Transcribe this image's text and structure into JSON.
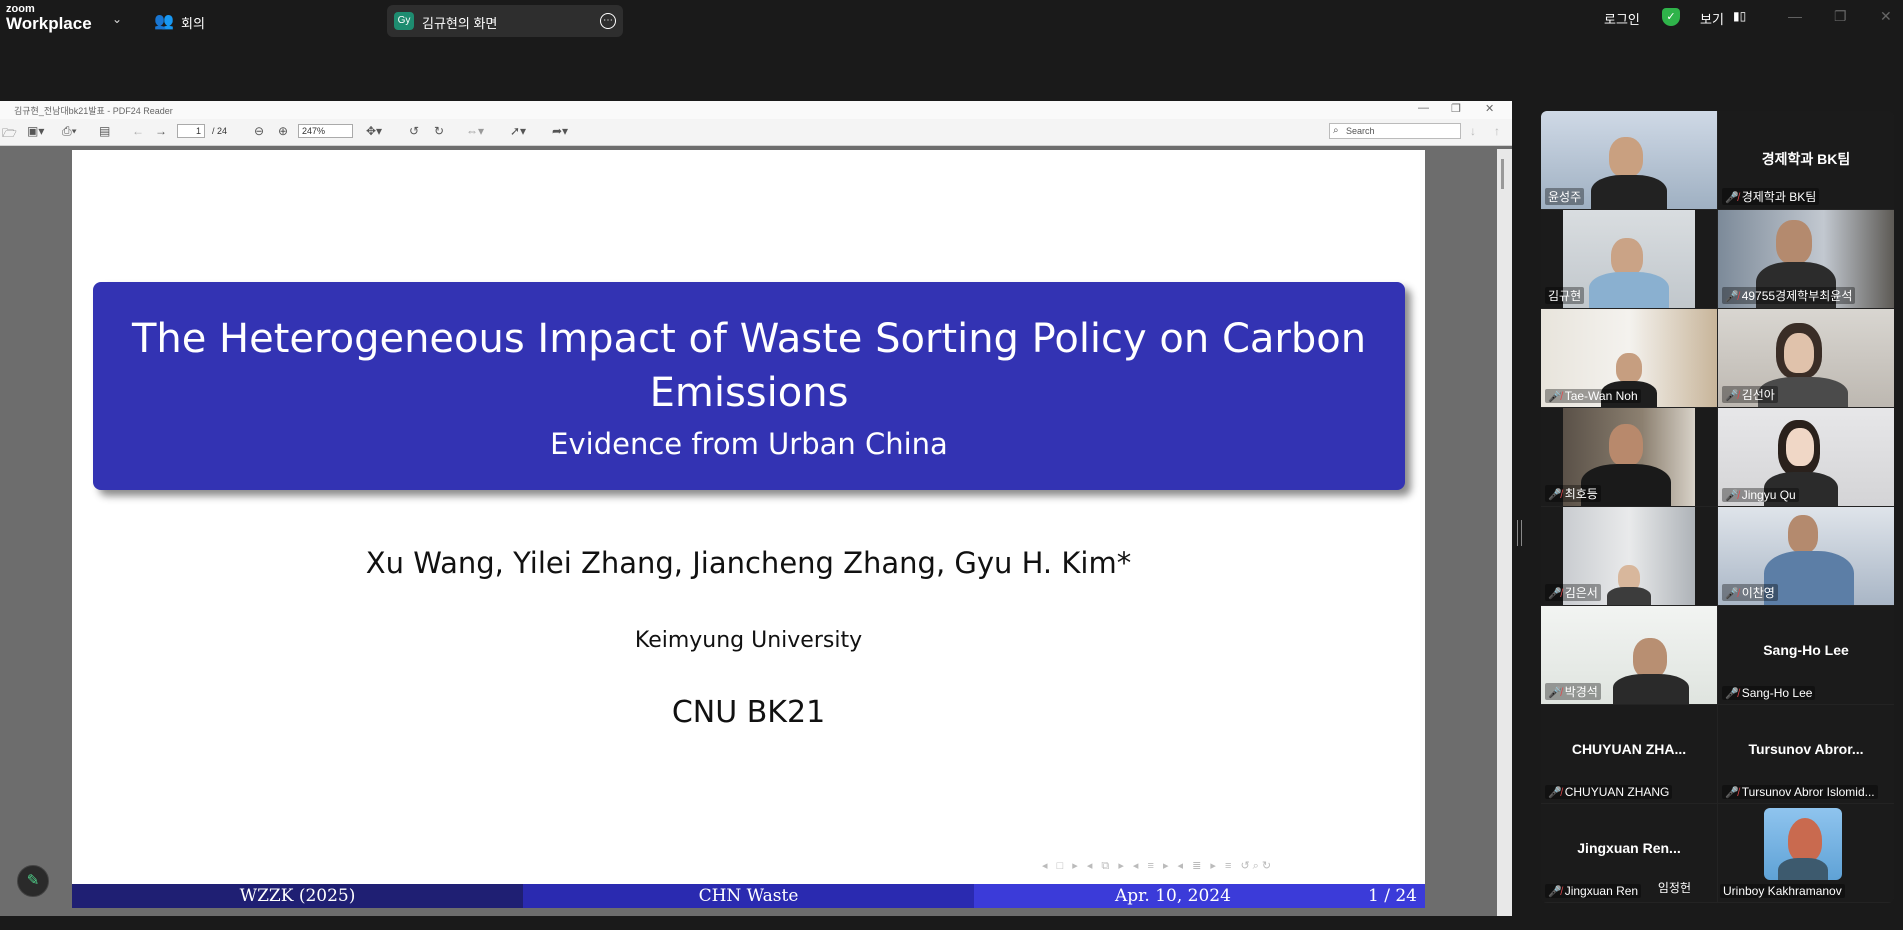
{
  "topbar": {
    "logo_small": "zoom",
    "logo_big": "Workplace",
    "meeting_label": "회의",
    "share_badge": "Gy",
    "share_label": "김규현의 화면",
    "login_label": "로그인",
    "view_label": "보기"
  },
  "pdf": {
    "window_title": "김규현_전남대bk21발표 - PDF24 Reader",
    "page_current": "1",
    "page_total": "/ 24",
    "zoom": "247%",
    "search_placeholder": "Search"
  },
  "slide": {
    "title": "The Heterogeneous Impact of Waste Sorting Policy on Carbon Emissions",
    "subtitle": "Evidence from Urban China",
    "authors": "Xu Wang, Yilei Zhang, Jiancheng Zhang, Gyu H. Kim*",
    "institute": "Keimyung University",
    "event": "CNU BK21",
    "footer_left": "WZZK (2025)",
    "footer_mid": "CHN Waste",
    "footer_date": "Apr. 10, 2024",
    "footer_page": "1 / 24",
    "colors": {
      "title_box": "#3333b3",
      "footer_dark": "#1f1f73",
      "footer_mid": "#2a2ab0",
      "footer_light": "#3b3bd9"
    }
  },
  "gallery": [
    {
      "name": "윤성주",
      "muted": false,
      "video": true
    },
    {
      "name": "경제학과 BK팀",
      "display": "경제학과 BK팀",
      "muted": true,
      "video": false
    },
    {
      "name": "김규현",
      "muted": false,
      "video": true,
      "active": true
    },
    {
      "name": "49755경제학부최윤석",
      "muted": true,
      "video": true
    },
    {
      "name": "Tae-Wan Noh",
      "muted": true,
      "video": true
    },
    {
      "name": "김선아",
      "muted": true,
      "video": true
    },
    {
      "name": "최호등",
      "muted": true,
      "video": true
    },
    {
      "name": "Jingyu Qu",
      "muted": true,
      "video": true
    },
    {
      "name": "김은서",
      "muted": true,
      "video": true
    },
    {
      "name": "이찬영",
      "muted": true,
      "video": true
    },
    {
      "name": "박경석",
      "muted": true,
      "video": true
    },
    {
      "name": "Sang-Ho Lee",
      "display": "Sang-Ho Lee",
      "muted": true,
      "video": false
    },
    {
      "name": "CHUYUAN ZHANG",
      "display": "CHUYUAN  ZHA...",
      "muted": true,
      "video": false
    },
    {
      "name": "Tursunov Abror Islomid...",
      "display": "Tursunov  Abror...",
      "muted": true,
      "video": false
    },
    {
      "name": "Jingxuan Ren",
      "display": "Jingxuan  Ren...",
      "extra": "임정헌",
      "muted": true,
      "video": false
    },
    {
      "name": "Urinboy Kakhramanov",
      "muted": false,
      "video": false,
      "avatar": true
    }
  ]
}
